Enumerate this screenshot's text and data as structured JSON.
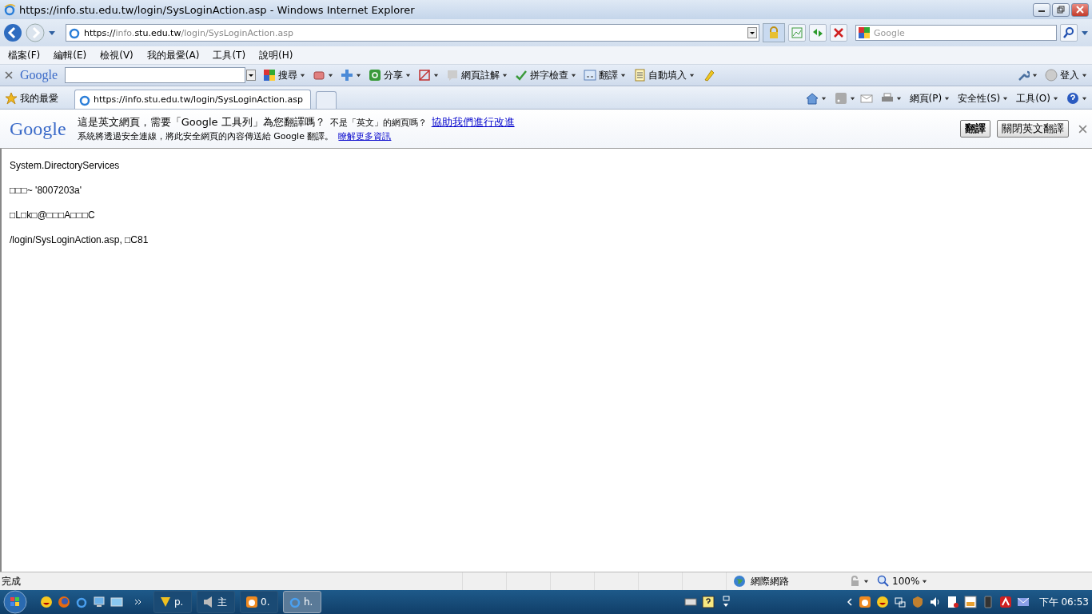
{
  "window": {
    "title": "https://info.stu.edu.tw/login/SysLoginAction.asp - Windows Internet Explorer"
  },
  "address_bar": {
    "url_scheme": "https://",
    "url_host_dim": "info.",
    "url_host": "stu.edu.tw",
    "url_path": "/login/SysLoginAction.asp"
  },
  "search": {
    "placeholder": "Google"
  },
  "menu": [
    "檔案(F)",
    "編輯(E)",
    "檢視(V)",
    "我的最愛(A)",
    "工具(T)",
    "說明(H)"
  ],
  "google_toolbar": {
    "logo": "Google",
    "items": [
      {
        "kind": "search",
        "label": "搜尋"
      },
      {
        "kind": "share",
        "label": "分享"
      },
      {
        "kind": "notes",
        "label": "網頁註解"
      },
      {
        "kind": "spell",
        "label": "拼字檢查"
      },
      {
        "kind": "translate",
        "label": "翻譯"
      },
      {
        "kind": "autofill",
        "label": "自動填入"
      }
    ],
    "sign_in": "登入"
  },
  "favorites_bar": {
    "favorites": "我的最愛",
    "tabs": [
      {
        "label": "https://info.stu.edu.tw/login/SysLoginAction.asp",
        "selected": true
      }
    ],
    "commands": [
      "網頁(P)",
      "安全性(S)",
      "工具(O)"
    ]
  },
  "translate_bar": {
    "logo": "Google",
    "message": "這是英文網頁，需要「Google 工具列」為您翻譯嗎？",
    "question": "不是「英文」的網頁嗎？",
    "help_link": "協助我們進行改進",
    "note": "系統將透過安全連線，將此安全網頁的內容傳送給 Google 翻譯。",
    "learn_link": "瞭解更多資訊",
    "buttons": [
      "翻譯",
      "關閉英文翻譯"
    ]
  },
  "page_lines": [
    "System.DirectoryServices",
    "□□□~ '8007203a'",
    "□L□k□@□□□A□□□C",
    "/login/SysLoginAction.asp, □C81"
  ],
  "status_bar": {
    "status": "完成",
    "zone": "網際網路",
    "zoom": "100%"
  },
  "taskbar": {
    "buttons": [
      {
        "kind": "pen",
        "label": "p.",
        "selected": false
      },
      {
        "kind": "speaker",
        "label": "主",
        "selected": false
      },
      {
        "kind": "chat",
        "label": "0.",
        "selected": false
      },
      {
        "kind": "ie",
        "label": "h.",
        "selected": true
      }
    ],
    "clock": "下午 06:53"
  }
}
